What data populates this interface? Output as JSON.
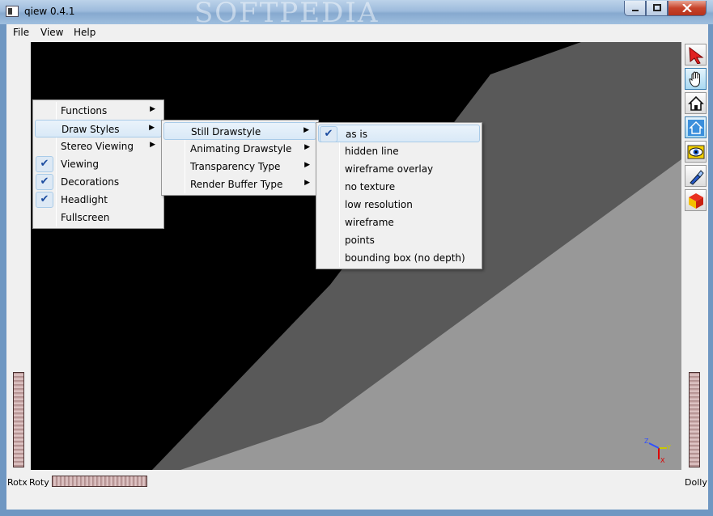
{
  "window": {
    "title": "qiew 0.4.1",
    "watermark": "SOFTPEDIA"
  },
  "menubar": {
    "items": [
      "File",
      "View",
      "Help"
    ]
  },
  "view_menu": {
    "items": [
      {
        "label": "Functions",
        "submenu": true
      },
      {
        "label": "Draw Styles",
        "submenu": true,
        "highlighted": true
      },
      {
        "label": "Stereo Viewing",
        "submenu": true
      },
      {
        "label": "Viewing",
        "checked": true
      },
      {
        "label": "Decorations",
        "checked": true
      },
      {
        "label": "Headlight",
        "checked": true
      },
      {
        "label": "Fullscreen"
      }
    ]
  },
  "draw_styles_menu": {
    "items": [
      {
        "label": "Still Drawstyle",
        "submenu": true,
        "highlighted": true
      },
      {
        "label": "Animating Drawstyle",
        "submenu": true
      },
      {
        "label": "Transparency Type",
        "submenu": true
      },
      {
        "label": "Render Buffer Type",
        "submenu": true
      }
    ]
  },
  "still_drawstyle_menu": {
    "items": [
      {
        "label": "as is",
        "checked": true,
        "highlighted": true
      },
      {
        "label": "hidden line"
      },
      {
        "label": "wireframe overlay"
      },
      {
        "label": "no texture"
      },
      {
        "label": "low resolution"
      },
      {
        "label": "wireframe"
      },
      {
        "label": "points"
      },
      {
        "label": "bounding box (no depth)"
      }
    ]
  },
  "toolbar": {
    "buttons": [
      {
        "icon": "select-arrow-icon",
        "active": false
      },
      {
        "icon": "hand-pan-icon",
        "active": true
      },
      {
        "icon": "home-icon",
        "active": false
      },
      {
        "icon": "set-home-icon",
        "active": false
      },
      {
        "icon": "view-all-icon",
        "active": false
      },
      {
        "icon": "seek-flashlight-icon",
        "active": false
      },
      {
        "icon": "projection-cube-icon",
        "active": false
      }
    ]
  },
  "wheels": {
    "rotx_label": "Rotx",
    "roty_label": "Roty",
    "dolly_label": "Dolly"
  },
  "axis": {
    "x": "X",
    "y": "Y",
    "z": "Z"
  },
  "colors": {
    "menu_check": "#1b4ca0",
    "viewer_bg": "#000000",
    "shape_dark": "#595959",
    "shape_light": "#989898"
  }
}
